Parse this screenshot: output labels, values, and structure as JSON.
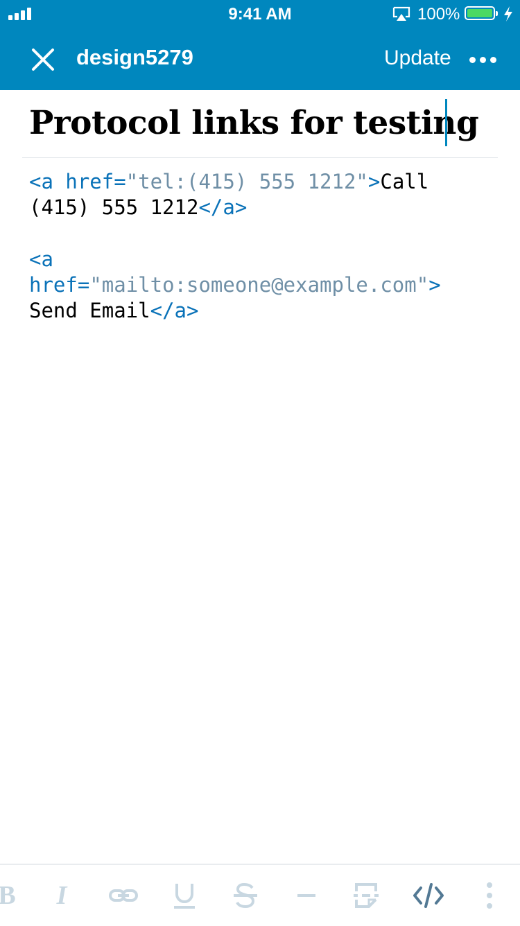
{
  "colors": {
    "brand": "#0087be",
    "battery": "#4cd964",
    "html_tag": "#0a72b8",
    "html_value": "#6f8fa6",
    "tool_dim": "#c8d7e1",
    "tool_active": "#537994"
  },
  "status_bar": {
    "time": "9:41 AM",
    "battery_percent": "100%",
    "icons": [
      "signal-icon",
      "airplay-icon",
      "battery-icon",
      "charging-icon"
    ]
  },
  "nav_bar": {
    "close_icon": "close-icon",
    "site_name": "design5279",
    "update_label": "Update",
    "more_icon": "more-icon"
  },
  "post": {
    "title": "Protocol links for testing",
    "blocks": [
      {
        "lines": [
          [
            [
              "tag",
              "<a href="
            ],
            [
              "val",
              "\"tel:(415) 555 1212\""
            ],
            [
              "tag",
              ">"
            ],
            [
              "text",
              "Call"
            ]
          ],
          [
            [
              "text",
              "(415) 555 1212"
            ],
            [
              "tag",
              "</a>"
            ]
          ]
        ]
      },
      {
        "lines": [
          [
            [
              "tag",
              "<a"
            ]
          ],
          [
            [
              "tag",
              "href="
            ],
            [
              "val",
              "\"mailto:someone@example.com\""
            ],
            [
              "tag",
              ">"
            ]
          ],
          [
            [
              "text",
              "Send Email"
            ],
            [
              "tag",
              "</a>"
            ]
          ]
        ]
      }
    ]
  },
  "toolbar": {
    "items": [
      {
        "icon": "bold-icon",
        "glyph": "B",
        "active": false
      },
      {
        "icon": "italic-icon",
        "glyph": "I",
        "active": false
      },
      {
        "icon": "link-icon",
        "glyph": "",
        "active": false
      },
      {
        "icon": "underline-icon",
        "glyph": "U",
        "active": false
      },
      {
        "icon": "strikethrough-icon",
        "glyph": "S",
        "active": false
      },
      {
        "icon": "horizontal-rule-icon",
        "glyph": "",
        "active": false
      },
      {
        "icon": "read-more-icon",
        "glyph": "",
        "active": false
      },
      {
        "icon": "html-mode-icon",
        "glyph": "",
        "active": true
      },
      {
        "icon": "more-vertical-icon",
        "glyph": "",
        "active": false
      }
    ]
  }
}
